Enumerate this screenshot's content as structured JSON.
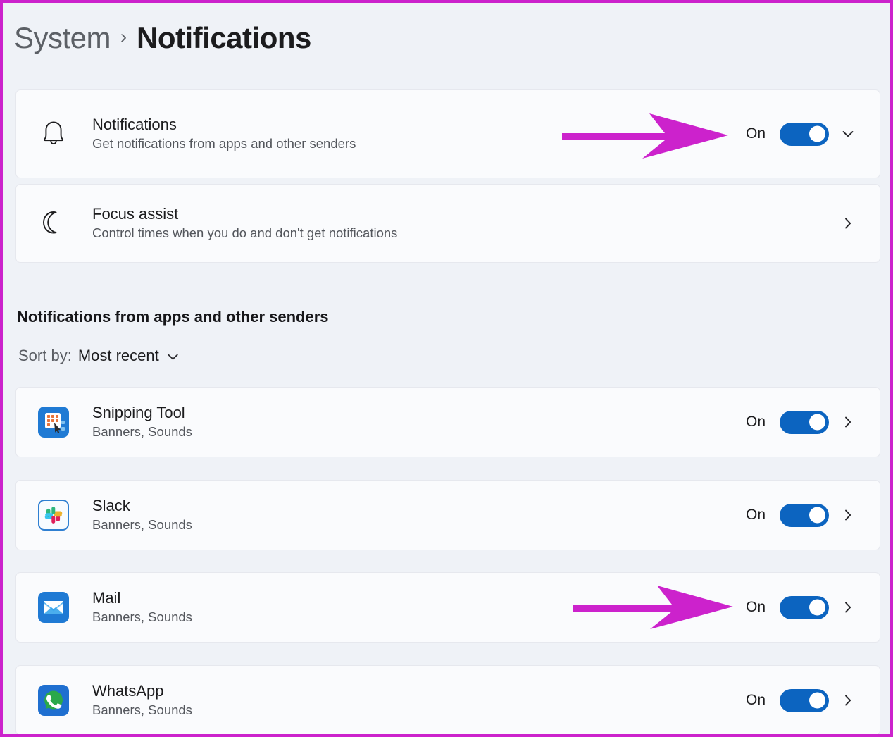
{
  "annotation": {
    "frame_color": "#cc22cc",
    "arrow_color": "#cc22cc",
    "arrow_count": 2
  },
  "theme": {
    "page_background": "#eff2f7",
    "card_background": "#fafbfd",
    "card_border": "#e6e8ee",
    "toggle_on_color": "#0c64c0",
    "title_color": "#1c1c1e",
    "subtitle_color": "#53565c"
  },
  "breadcrumb": {
    "root": "System",
    "separator": "›",
    "current": "Notifications"
  },
  "top_settings": [
    {
      "icon": "bell-icon",
      "title": "Notifications",
      "subtitle": "Get notifications from apps and other senders",
      "state_label": "On",
      "has_toggle": true,
      "toggle_state": "on",
      "chevron": "chevron-down-icon",
      "annotated": true
    },
    {
      "icon": "moon-icon",
      "title": "Focus assist",
      "subtitle": "Control times when you do and don't get notifications",
      "state_label": "",
      "has_toggle": false,
      "toggle_state": "",
      "chevron": "chevron-right-icon",
      "annotated": false
    }
  ],
  "apps_section": {
    "heading": "Notifications from apps and other senders",
    "sort": {
      "label": "Sort by:",
      "value": "Most recent",
      "chevron": "chevron-down-icon"
    },
    "apps": [
      {
        "icon": "snipping-tool-icon",
        "name": "Snipping Tool",
        "subtitle": "Banners, Sounds",
        "state_label": "On",
        "toggle_state": "on",
        "chevron": "chevron-right-icon",
        "annotated": false
      },
      {
        "icon": "slack-icon",
        "name": "Slack",
        "subtitle": "Banners, Sounds",
        "state_label": "On",
        "toggle_state": "on",
        "chevron": "chevron-right-icon",
        "annotated": false
      },
      {
        "icon": "mail-icon",
        "name": "Mail",
        "subtitle": "Banners, Sounds",
        "state_label": "On",
        "toggle_state": "on",
        "chevron": "chevron-right-icon",
        "annotated": true
      },
      {
        "icon": "whatsapp-icon",
        "name": "WhatsApp",
        "subtitle": "Banners, Sounds",
        "state_label": "On",
        "toggle_state": "on",
        "chevron": "chevron-right-icon",
        "annotated": false
      }
    ]
  }
}
